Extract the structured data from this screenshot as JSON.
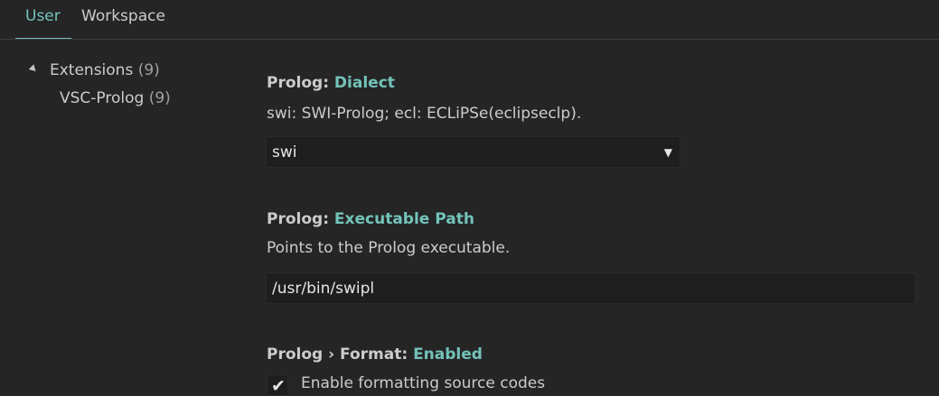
{
  "tabs": [
    {
      "label": "User",
      "active": true
    },
    {
      "label": "Workspace",
      "active": false
    }
  ],
  "tree": {
    "extensions": {
      "label": "Extensions",
      "count": "(9)",
      "expanded": true
    },
    "vsc_prolog": {
      "label": "VSC-Prolog",
      "count": "(9)"
    }
  },
  "settings": {
    "dialect": {
      "prefix": "Prolog: ",
      "key": "Dialect",
      "description": "swi: SWI-Prolog; ecl: ECLiPSe(eclipseclp).",
      "value": "swi",
      "arrow": "▼"
    },
    "executable_path": {
      "prefix": "Prolog: ",
      "key": "Executable Path",
      "description": "Points to the Prolog executable.",
      "value": "/usr/bin/swipl"
    },
    "format_enabled": {
      "prefix": "Prolog › Format: ",
      "key": "Enabled",
      "checkbox_label": "Enable formatting source codes",
      "checked": true,
      "check_glyph": "✔"
    }
  },
  "colors": {
    "background": "#252526",
    "accent": "#73c3b9",
    "input_background": "#1e1e1e",
    "text": "#cccccc"
  }
}
